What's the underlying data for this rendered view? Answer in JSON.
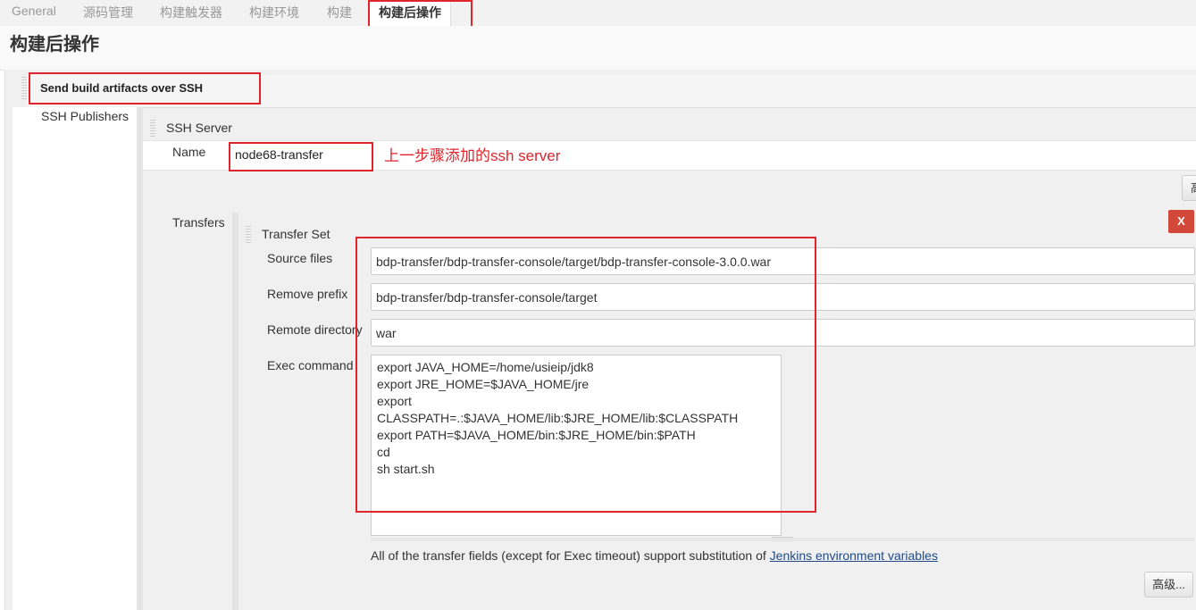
{
  "tabs": [
    "General",
    "源码管理",
    "构建触发器",
    "构建环境",
    "构建",
    "构建后操作"
  ],
  "page_title": "构建后操作",
  "section": {
    "title": "Send build artifacts over SSH",
    "publishers_label": "SSH Publishers",
    "server_label": "SSH Server",
    "name_label": "Name",
    "name_value": "node68-transfer",
    "annotation": "上一步骤添加的ssh server",
    "transfers_label": "Transfers",
    "transfer_set_label": "Transfer Set",
    "delete_label": "X",
    "source_files_label": "Source files",
    "source_files_value": "bdp-transfer/bdp-transfer-console/target/bdp-transfer-console-3.0.0.war",
    "remove_prefix_label": "Remove prefix",
    "remove_prefix_value": "bdp-transfer/bdp-transfer-console/target",
    "remote_dir_label": "Remote directory",
    "remote_dir_value": "war",
    "exec_command_label": "Exec command",
    "exec_command_value": "export JAVA_HOME=/home/usieip/jdk8\nexport JRE_HOME=$JAVA_HOME/jre\nexport\nCLASSPATH=.:$JAVA_HOME/lib:$JRE_HOME/lib:$CLASSPATH\nexport PATH=$JAVA_HOME/bin:$JRE_HOME/bin:$PATH\ncd\nsh start.sh",
    "help_text": "All of the transfer fields (except for Exec timeout) support substitution of",
    "help_link": "Jenkins environment variables",
    "advanced_label": "高级...",
    "advanced_partial_label": "高"
  },
  "colors": {
    "highlight": "#e0242c",
    "link": "#204a87",
    "danger": "#d24939"
  }
}
